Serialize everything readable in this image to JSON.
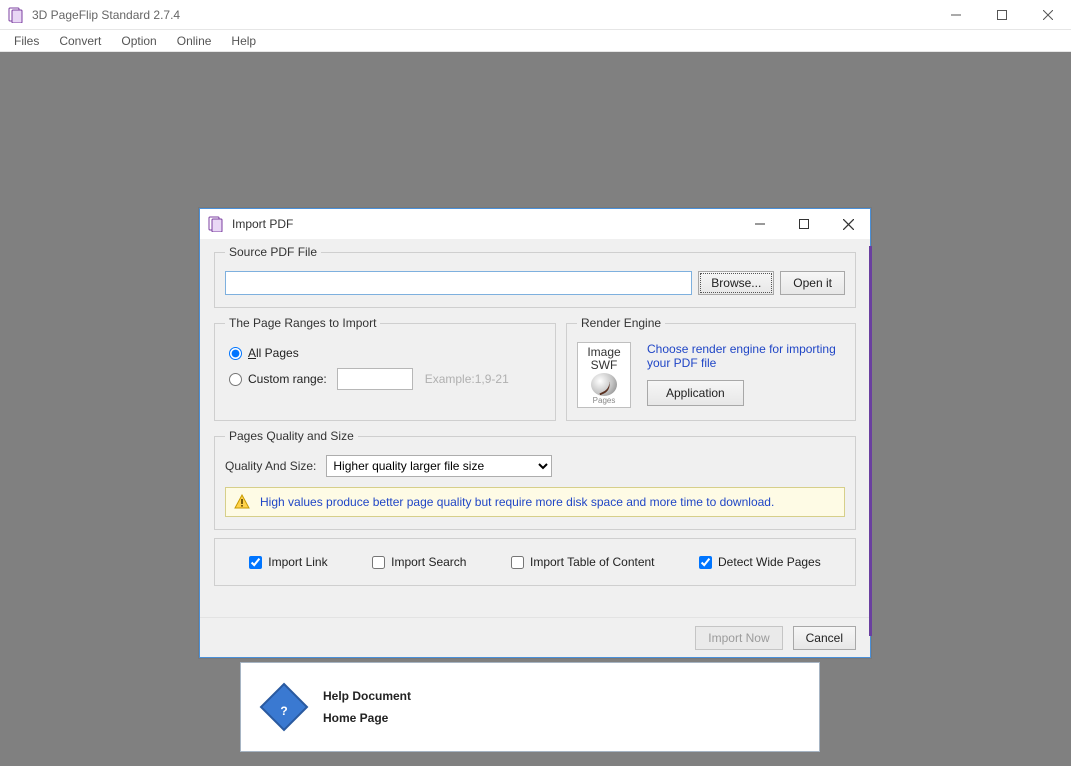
{
  "app": {
    "title": "3D PageFlip Standard 2.7.4"
  },
  "menu": {
    "items": [
      "Files",
      "Convert",
      "Option",
      "Online",
      "Help"
    ]
  },
  "help_panel": {
    "doc": "Help Document",
    "home": "Home Page"
  },
  "dialog": {
    "title": "Import PDF",
    "source": {
      "legend": "Source PDF File",
      "path": "",
      "browse": "Browse...",
      "open": "Open it"
    },
    "ranges": {
      "legend": "The Page Ranges to Import",
      "all_prefix": "A",
      "all_rest": "ll Pages",
      "custom_label": "Custom range:",
      "custom_value": "",
      "example": "Example:1,9-21"
    },
    "render": {
      "legend": "Render Engine",
      "thumb_line1": "Image",
      "thumb_line2": "SWF",
      "thumb_pages": "Pages",
      "hint": "Choose render engine for importing your PDF file",
      "app_btn": "Application"
    },
    "quality": {
      "legend": "Pages Quality and Size",
      "label": "Quality And Size:",
      "selected": "Higher quality larger file size",
      "info": "High values produce better page quality but require more disk space and more time to download."
    },
    "opts": {
      "link": "Import Link",
      "search": "Import Search",
      "toc": "Import Table of Content",
      "wide": "Detect Wide Pages"
    },
    "footer": {
      "import": "Import Now",
      "cancel": "Cancel"
    }
  }
}
